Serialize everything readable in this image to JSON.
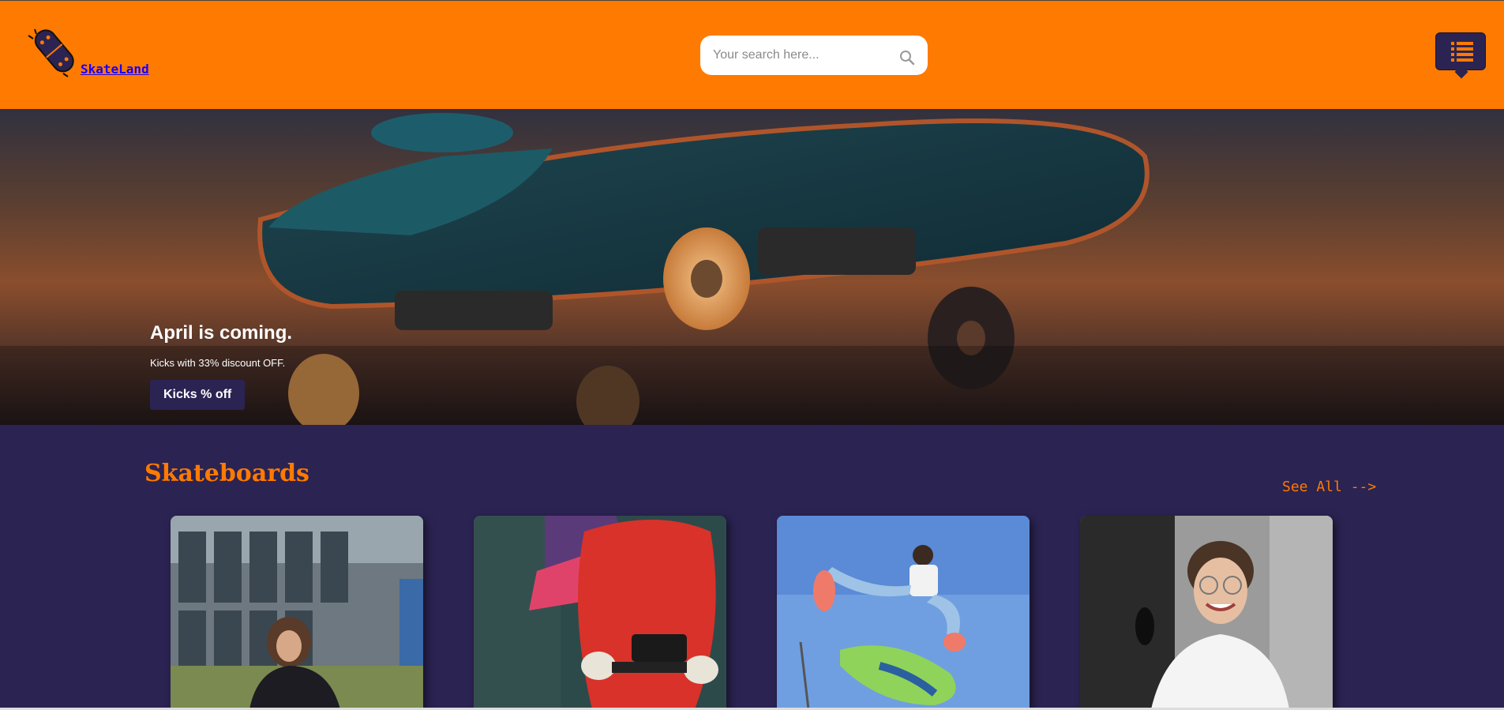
{
  "header": {
    "logo_text": " SkateLand",
    "search_placeholder": "Your search here...",
    "menu_icon": "list-icon"
  },
  "hero": {
    "title": "April is coming.",
    "subtitle": "Kicks with 33% discount OFF.",
    "button_label": "Kicks % off"
  },
  "skateboards": {
    "title": "Skateboards",
    "see_all": "See All -->",
    "cards": [
      {
        "image": "skater-sitting-building"
      },
      {
        "image": "red-skateboard-closeup"
      },
      {
        "image": "skater-jump-blue-sky"
      },
      {
        "image": "smiling-young-man"
      }
    ]
  },
  "colors": {
    "accent": "#ff7a00",
    "dark": "#2b2352"
  }
}
